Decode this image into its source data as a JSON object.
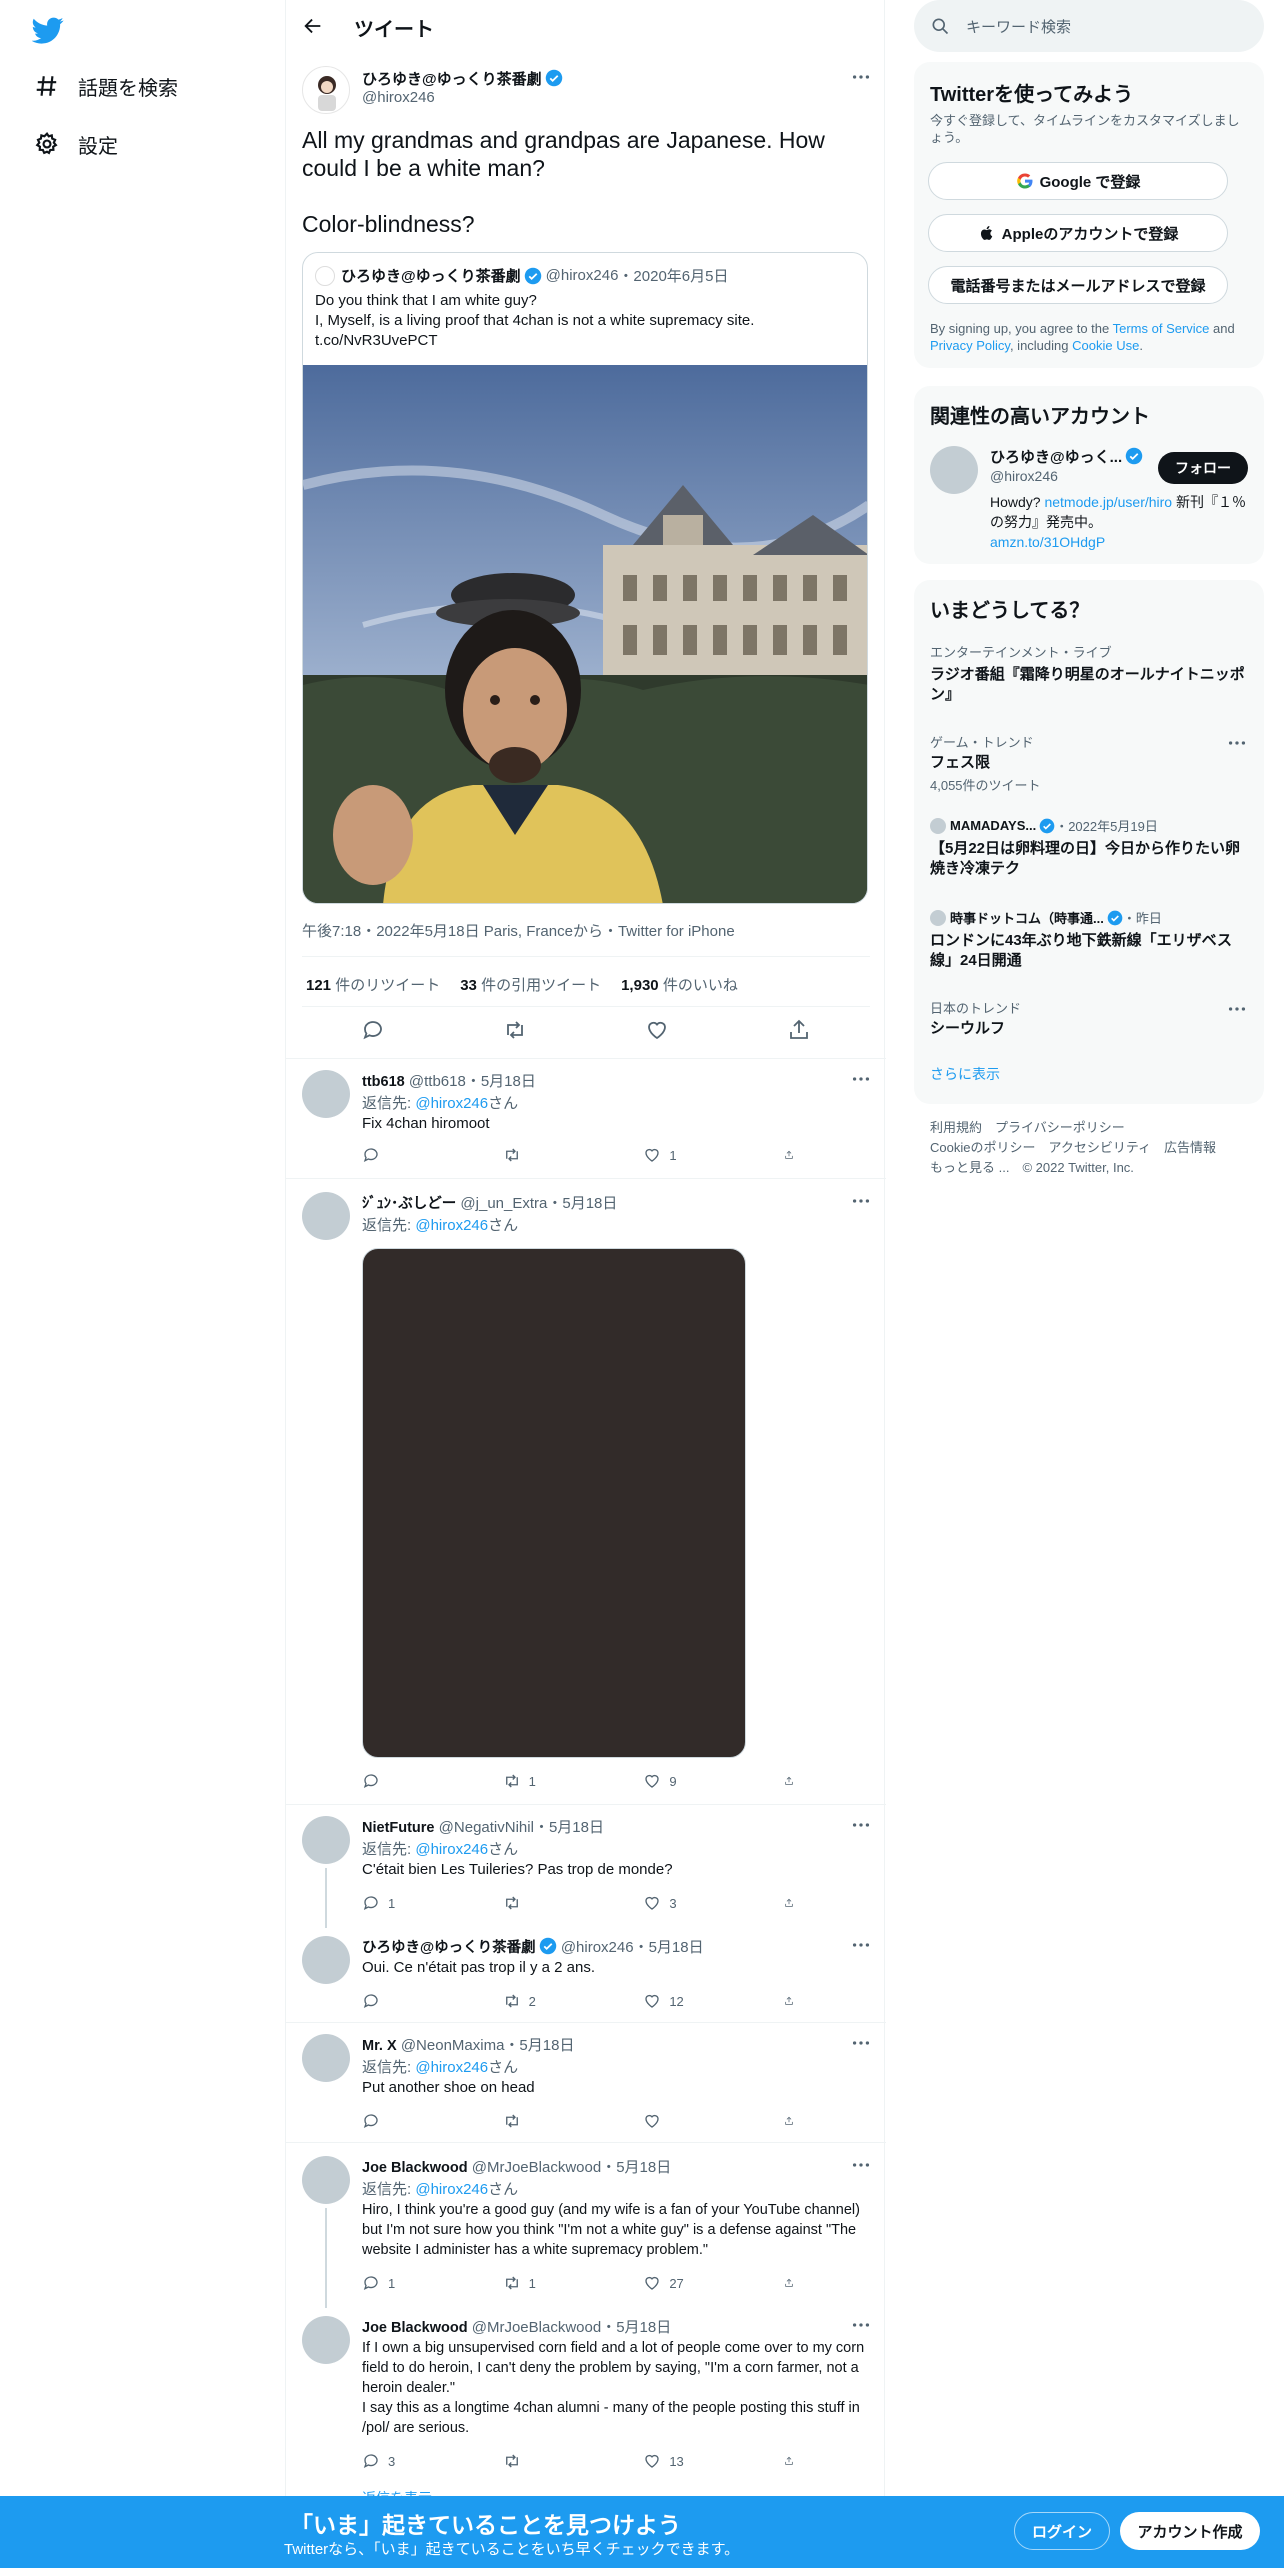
{
  "colors": {
    "brand": "#1d9bf0",
    "text": "#0f1419",
    "muted": "#536471",
    "border": "#eff3f4",
    "bar": "#1d9bf0"
  },
  "nav": {
    "logo_icon": "twitter-bird-icon",
    "items": [
      {
        "label": "話題を検索",
        "icon": "hashtag-icon"
      },
      {
        "label": "設定",
        "icon": "gear-icon"
      }
    ]
  },
  "header": {
    "title": "ツイート"
  },
  "tweet": {
    "name": "ひろゆき@ゆっくり茶番劇",
    "handle": "@hirox246",
    "text_1": "All my grandmas and grandpas are Japanese. How could I be a white man?",
    "text_2": "Color-blindness?",
    "quote": {
      "name": "ひろゆき@ゆっくり茶番劇",
      "handle": "@hirox246",
      "date": "・2020年6月5日",
      "line1": "Do you think that I am white guy?",
      "line2": "I, Myself, is a living proof that 4chan is not a white supremacy site.",
      "line3": "t.co/NvR3UvePCT"
    },
    "meta": "午後7:18・2022年5月18日 Paris, Franceから・Twitter for iPhone",
    "stats": {
      "retweets": "121",
      "retweets_label": "件のリツイート",
      "quotes": "33",
      "quotes_label": "件の引用ツイート",
      "likes": "1,930",
      "likes_label": "件のいいね"
    }
  },
  "replies": [
    {
      "name": "ttb618",
      "handle": "@ttb618",
      "date": "・5月18日",
      "to_prefix": "返信先: ",
      "to": "@hirox246",
      "to_suffix": "さん",
      "text": "Fix 4chan hiromoot",
      "reply_count": "",
      "rt_count": "",
      "like_count": "1"
    },
    {
      "name": "ｼﾞｭﾝ･ぶしどー",
      "handle": "@j_un_Extra",
      "date": "・5月18日",
      "to_prefix": "返信先: ",
      "to": "@hirox246",
      "to_suffix": "さん",
      "text": "",
      "reply_count": "",
      "rt_count": "1",
      "like_count": "9"
    },
    {
      "name": "NietFuture",
      "handle": "@NegativNihil",
      "date": "・5月18日",
      "to_prefix": "返信先: ",
      "to": "@hirox246",
      "to_suffix": "さん",
      "text": "C'était bien Les Tuileries? Pas trop de monde?",
      "reply_count": "1",
      "rt_count": "",
      "like_count": "3"
    },
    {
      "name": "ひろゆき@ゆっくり茶番劇",
      "handle": "@hirox246",
      "date": "・5月18日",
      "text": "Oui. Ce n'était pas trop il y a 2 ans.",
      "reply_count": "",
      "rt_count": "2",
      "like_count": "12"
    },
    {
      "name": "Mr. X",
      "handle": "@NeonMaxima",
      "date": "・5月18日",
      "to_prefix": "返信先: ",
      "to": "@hirox246",
      "to_suffix": "さん",
      "text": "Put another shoe on head",
      "reply_count": "",
      "rt_count": "",
      "like_count": ""
    },
    {
      "name": "Joe Blackwood",
      "handle": "@MrJoeBlackwood",
      "date": "・5月18日",
      "to_prefix": "返信先: ",
      "to": "@hirox246",
      "to_suffix": "さん",
      "text": "Hiro, I think you're a good guy (and my wife is a fan of your YouTube channel) but I'm not sure how you think \"I'm not a white guy\" is a defense against \"The website I administer has a white supremacy problem.\"",
      "reply_count": "1",
      "rt_count": "1",
      "like_count": "27"
    },
    {
      "name": "Joe Blackwood",
      "handle": "@MrJoeBlackwood",
      "date": "・5月18日",
      "text": "If I own a big unsupervised corn field and a lot of people come over to my corn field to do heroin, I can't deny the problem by saying, \"I'm a corn farmer, not a heroin dealer.\"\nI say this as a longtime 4chan alumni - many of the people posting this stuff in /pol/ are serious.",
      "reply_count": "3",
      "rt_count": "",
      "like_count": "13",
      "more": "返信を表示"
    }
  ],
  "right": {
    "search_placeholder": "キーワード検索",
    "signup": {
      "title": "Twitterを使ってみよう",
      "desc": "今すぐ登録して、タイムラインをカスタマイズしましょう。",
      "google": "Google で登録",
      "apple": "Appleのアカウントで登録",
      "phone": "電話番号またはメールアドレスで登録",
      "legal_1": "By signing up, you agree to the ",
      "tos": "Terms of Service",
      "legal_2": " and ",
      "privacy": "Privacy Policy",
      "legal_3": ", including ",
      "cookie": "Cookie Use",
      "legal_4": "."
    },
    "related": {
      "title": "関連性の高いアカウント",
      "name": "ひろゆき@ゆっく...",
      "handle": "@hirox246",
      "follow": "フォロー",
      "bio_1": "Howdy? ",
      "bio_link": "netmode.jp/user/hiro",
      "bio_2": " 新刊『１％の努力』発売中。",
      "bio_link2": "amzn.to/31OHdgP"
    },
    "trends": {
      "title": "いまどうしてる？",
      "items": [
        {
          "cat": "エンターテインメント・ライブ",
          "title": "ラジオ番組『霜降り明星のオールナイトニッポン』",
          "count": ""
        },
        {
          "cat": "ゲーム・トレンド",
          "title": "フェス限",
          "count": "4,055件のツイート"
        },
        {
          "cat": "MAMADAYS...",
          "cat_date": "・2022年5月19日",
          "title": "【5月22日は卵料理の日】今日から作りたい卵焼き冷凍テク",
          "count": ""
        },
        {
          "cat": "時事ドットコム（時事通...",
          "cat_date": "・昨日",
          "title": "ロンドンに43年ぶり地下鉄新線「エリザベス線」24日開通",
          "count": ""
        },
        {
          "cat": "日本のトレンド",
          "title": "シーウルフ",
          "count": ""
        }
      ],
      "show_more": "さらに表示"
    },
    "footer": {
      "line1": "利用規約　プライバシーポリシー",
      "line2": "Cookieのポリシー　アクセシビリティ　広告情報",
      "line3": "もっと見る ...　© 2022 Twitter, Inc."
    }
  },
  "bottom": {
    "headline": "「いま」起きていることを見つけよう",
    "sub": "Twitterなら、「いま」起きていることをいち早くチェックできます。",
    "login": "ログイン",
    "signup": "アカウント作成"
  }
}
